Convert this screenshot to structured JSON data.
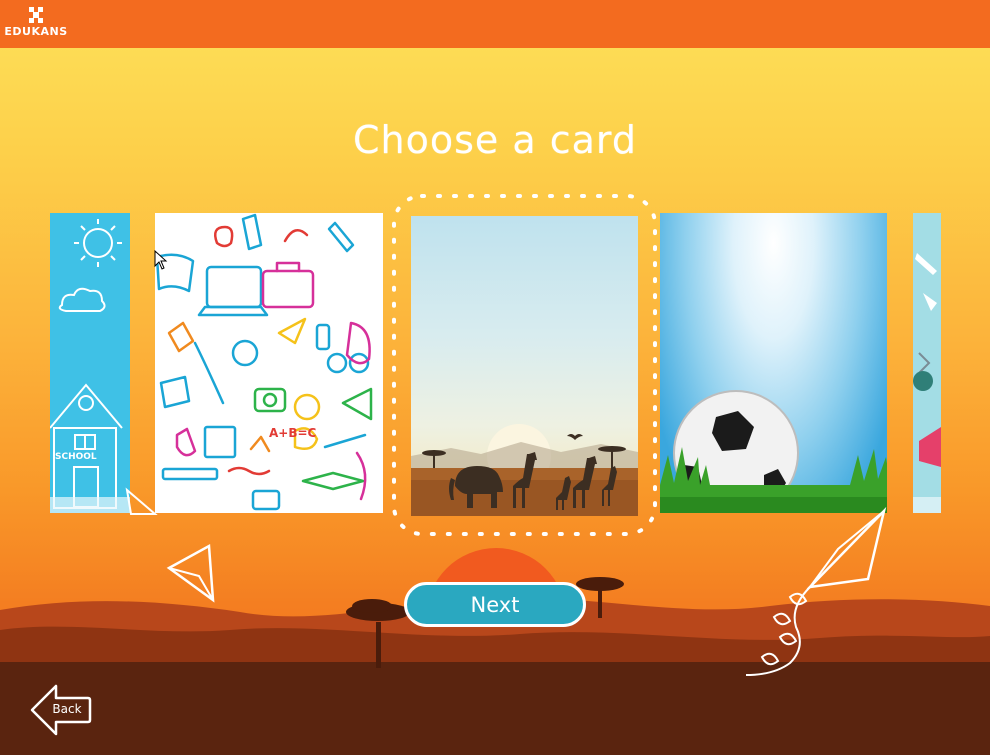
{
  "app": {
    "logo_text": "EDUKANS"
  },
  "page": {
    "title": "Choose a card"
  },
  "cards": [
    {
      "id": "school",
      "label": "SCHOOL",
      "selected": false
    },
    {
      "id": "doodle",
      "label": "A+B=C",
      "selected": false
    },
    {
      "id": "savanna",
      "label": "",
      "selected": true
    },
    {
      "id": "football",
      "label": "",
      "selected": false
    },
    {
      "id": "travel",
      "label": "",
      "selected": false
    }
  ],
  "buttons": {
    "next_label": "Next",
    "back_label": "Back"
  },
  "colors": {
    "topbar": "#f36b1f",
    "accent": "#2aa8c0",
    "school_card": "#3fc1e6",
    "ground": "#5a240f"
  }
}
